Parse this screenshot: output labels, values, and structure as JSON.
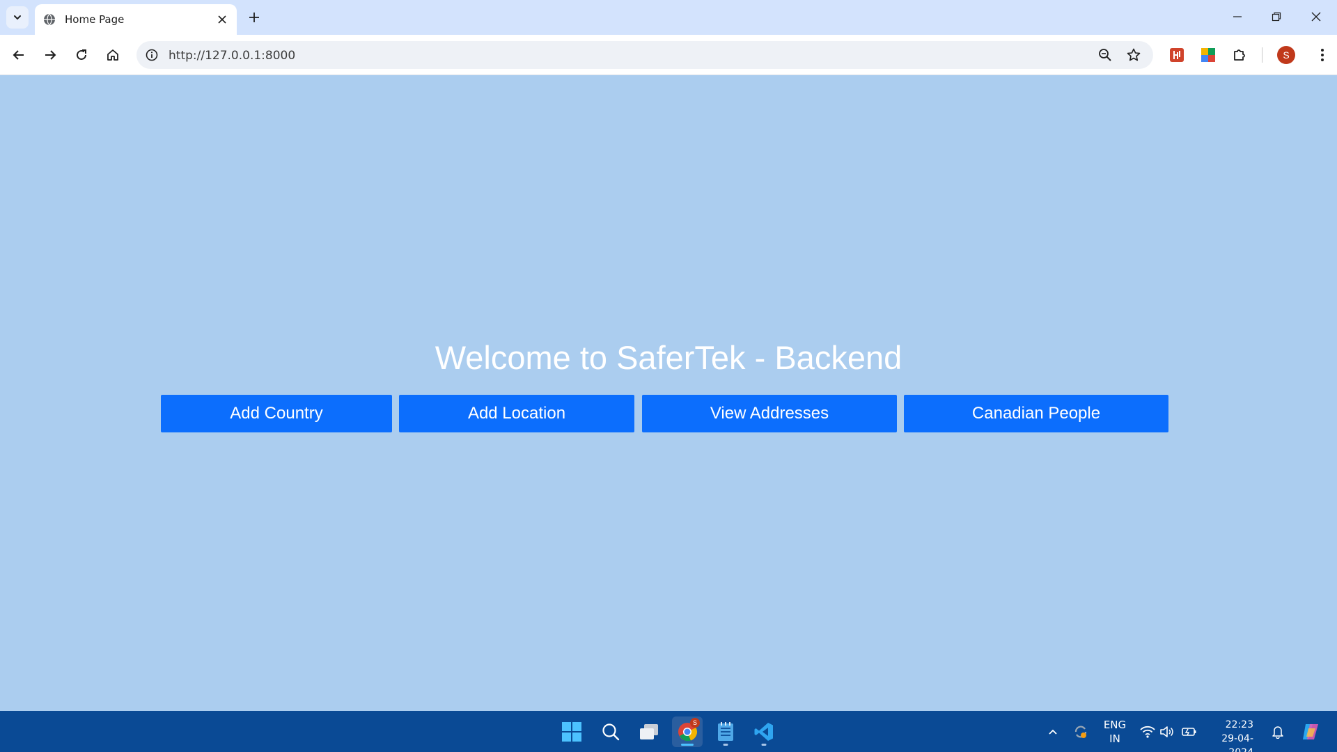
{
  "browser": {
    "tab_title": "Home Page",
    "url": "http://127.0.0.1:8000",
    "profile_initial": "S"
  },
  "page": {
    "title": "Welcome to SaferTek - Backend",
    "buttons": [
      {
        "label": "Add Country"
      },
      {
        "label": "Add Location"
      },
      {
        "label": "View Addresses"
      },
      {
        "label": "Canadian People"
      }
    ],
    "accent_color": "#0c6efd",
    "background_color": "#abcdef"
  },
  "taskbar": {
    "apps": [
      "start-icon",
      "search-icon",
      "task-view-icon",
      "chrome-icon",
      "notepad-icon",
      "vscode-icon"
    ],
    "chrome_badge": "S",
    "language_line1": "ENG",
    "language_line2": "IN",
    "time": "22:23",
    "date": "29-04-2024"
  }
}
